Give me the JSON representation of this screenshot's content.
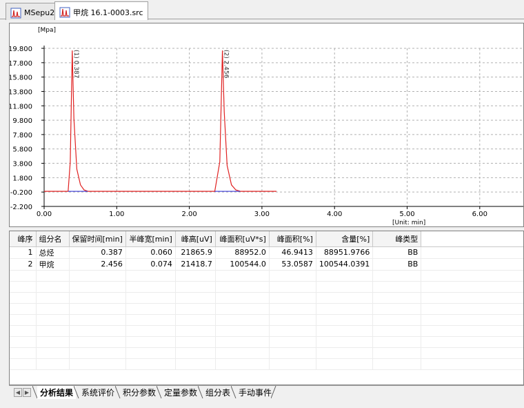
{
  "tabs": [
    {
      "label": "MSepu2",
      "icon": "chromatogram-icon"
    },
    {
      "label": "甲烷 16.1-0003.src",
      "icon": "chromatogram-file-icon"
    }
  ],
  "chart_data": {
    "type": "line",
    "ylabel": "[Mpa]",
    "xlabel": "[Unit: min]",
    "ylim": [
      -2.2,
      19.8
    ],
    "xlim": [
      0,
      6.6
    ],
    "y_ticks": [
      "19.800",
      "17.800",
      "15.800",
      "13.800",
      "11.800",
      "9.800",
      "7.800",
      "5.800",
      "3.800",
      "1.800",
      "-0.200",
      "-2.200"
    ],
    "y_tick_values": [
      19.8,
      17.8,
      15.8,
      13.8,
      11.8,
      9.8,
      7.8,
      5.8,
      3.8,
      1.8,
      -0.2,
      -2.2
    ],
    "x_ticks": [
      "0.00",
      "1.00",
      "2.00",
      "3.00",
      "4.00",
      "5.00",
      "6.00"
    ],
    "x_tick_values": [
      0,
      1,
      2,
      3,
      4,
      5,
      6
    ],
    "grid": true,
    "series": [
      {
        "color": "#e02020",
        "x": [
          0,
          0.33,
          0.36,
          0.387,
          0.41,
          0.45,
          0.5,
          0.55,
          0.6,
          2.35,
          2.42,
          2.456,
          2.48,
          2.52,
          2.58,
          2.64,
          2.7,
          3.2
        ],
        "y": [
          -0.1,
          -0.1,
          4.0,
          19.5,
          10.0,
          3.0,
          0.8,
          0.1,
          -0.1,
          -0.1,
          4.0,
          19.5,
          11.0,
          3.5,
          0.8,
          0.1,
          -0.1,
          -0.1
        ]
      },
      {
        "color": "#2020d0",
        "x": [
          0.33,
          0.6
        ],
        "y": [
          -0.1,
          -0.1
        ]
      },
      {
        "color": "#2020d0",
        "x": [
          2.35,
          2.7
        ],
        "y": [
          -0.1,
          -0.1
        ]
      }
    ],
    "annotations": [
      {
        "text": "(1) 0.387",
        "x": 0.387
      },
      {
        "text": "(2) 2.456",
        "x": 2.456
      }
    ]
  },
  "table": {
    "columns": [
      "峰序",
      "组分名",
      "保留时间[min]",
      "半峰宽[min]",
      "峰高[uV]",
      "峰面积[uV*s]",
      "峰面积[%]",
      "含量[%]",
      "峰类型"
    ],
    "rows": [
      [
        "1",
        "总烃",
        "0.387",
        "0.060",
        "21865.9",
        "88952.0",
        "46.9413",
        "88951.9766",
        "BB"
      ],
      [
        "2",
        "甲烷",
        "2.456",
        "0.074",
        "21418.7",
        "100544.0",
        "53.0587",
        "100544.0391",
        "BB"
      ]
    ]
  },
  "sheet_tabs": [
    "分析结果",
    "系统评价",
    "积分参数",
    "定量参数",
    "组分表",
    "手动事件"
  ],
  "active_sheet": "分析结果"
}
